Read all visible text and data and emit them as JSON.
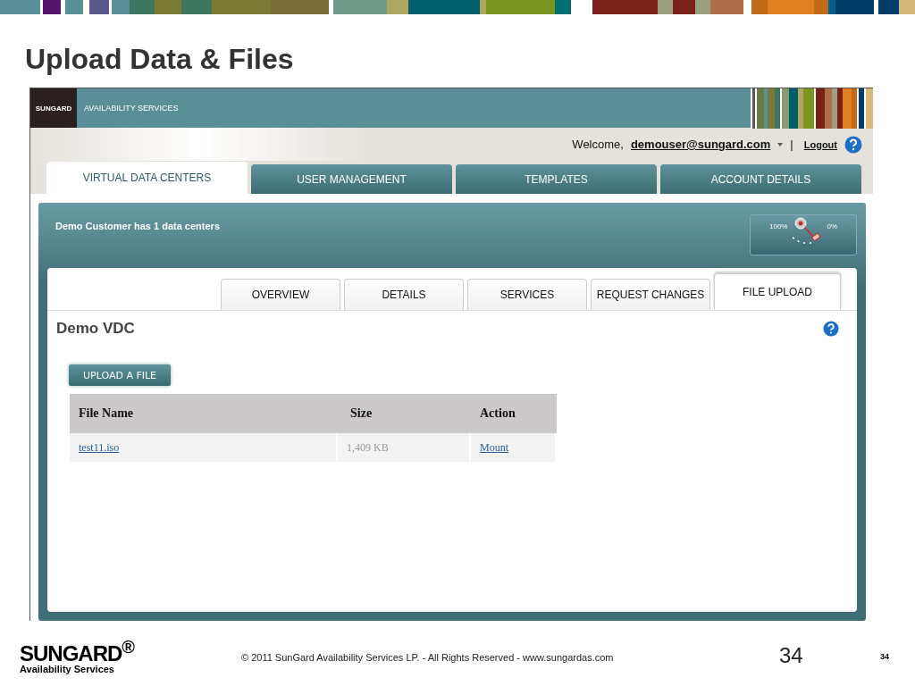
{
  "slide": {
    "title": "Upload Data & Files"
  },
  "app": {
    "header": {
      "logo": "SUNGARD",
      "subtitle": "AVAILABILITY SERVICES"
    },
    "user_bar": {
      "greeting": "Welcome,",
      "user": "demouser@sungard.com",
      "separator": "|",
      "logout": "Logout"
    },
    "tabs": [
      {
        "label": "VIRTUAL DATA CENTERS",
        "selected": true
      },
      {
        "label": "USER MANAGEMENT",
        "selected": false
      },
      {
        "label": "TEMPLATES",
        "selected": false
      },
      {
        "label": "ACCOUNT DETAILS",
        "selected": false
      }
    ],
    "panel": {
      "heading": "Demo Customer has 1 data centers",
      "gauge": {
        "max_label": "100%",
        "min_label": "0%"
      },
      "sub_tabs": [
        {
          "label": "OVERVIEW",
          "selected": false
        },
        {
          "label": "DETAILS",
          "selected": false
        },
        {
          "label": "SERVICES",
          "selected": false
        },
        {
          "label": "REQUEST CHANGES",
          "selected": false
        },
        {
          "label": "FILE UPLOAD",
          "selected": true
        }
      ],
      "title": "Demo VDC",
      "upload_button": "UPLOAD A FILE",
      "table": {
        "columns": [
          "File Name",
          "Size",
          "Action"
        ],
        "rows": [
          {
            "file_name": "test11.iso",
            "size": "1,409 KB",
            "action": "Mount"
          }
        ]
      }
    }
  },
  "footer": {
    "logo": "SUNGARD$^{®}$",
    "logo_subtitle": "Availability Services",
    "copyright": "© 2011 SunGard Availability Services LP. - All Rights Reserved - www.sungardas.com",
    "page_number": "34",
    "page_number_small": "34"
  }
}
